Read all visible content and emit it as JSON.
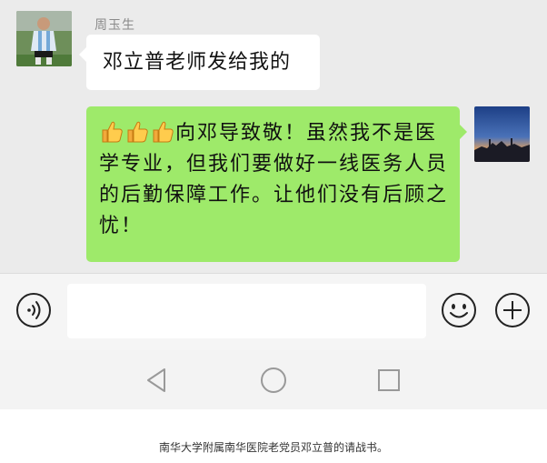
{
  "conversation": {
    "incoming": {
      "sender_name": "周玉生",
      "text": "邓立普老师发给我的",
      "avatar_icon": "football-player-avatar-icon"
    },
    "outgoing": {
      "emoji": "👍👍👍",
      "text": "向邓导致敬！虽然我不是医学专业，但我们要做好一线医务人员的后勤保障工作。让他们没有后顾之忧！",
      "avatar_icon": "sunset-avatar-icon"
    }
  },
  "input_bar": {
    "placeholder": "",
    "voice_icon": "voice-icon",
    "emoji_icon": "emoji-icon",
    "add_icon": "plus-icon"
  },
  "navigation": {
    "back_icon": "nav-back-icon",
    "home_icon": "nav-home-icon",
    "recent_icon": "nav-recent-icon"
  },
  "caption": "南华大学附属南华医院老党员邓立普的请战书。",
  "colors": {
    "chat_background": "#ebebeb",
    "outgoing_bubble": "#9eea6a",
    "incoming_bubble": "#ffffff",
    "input_bar": "#f5f5f5"
  }
}
